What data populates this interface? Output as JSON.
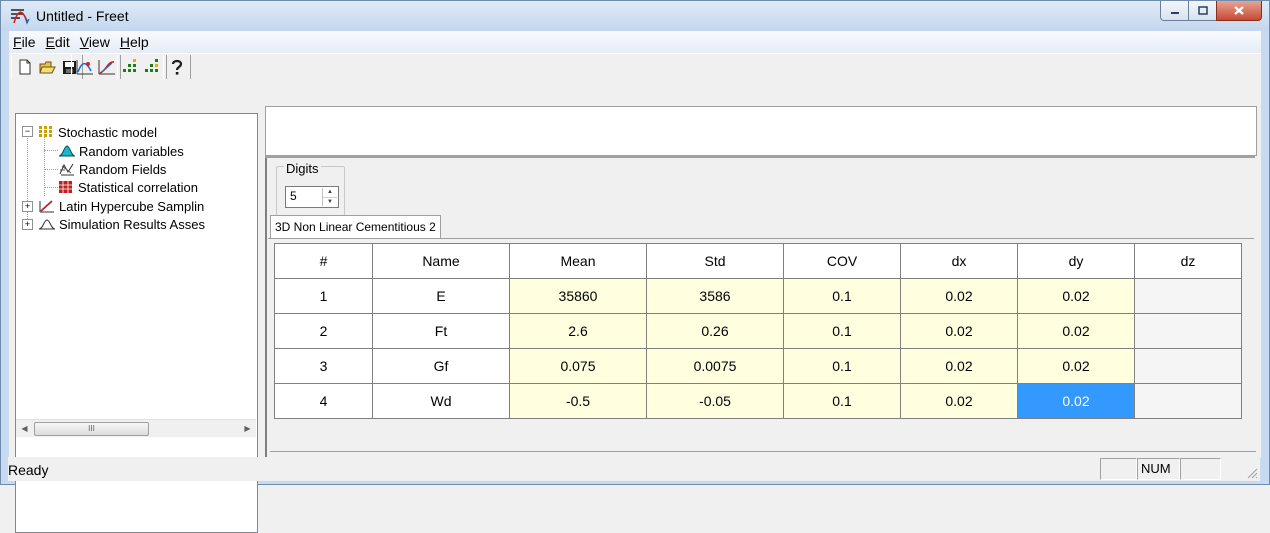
{
  "window": {
    "title": "Untitled - Freet"
  },
  "menu": [
    {
      "mnemonic": "F",
      "rest": "ile"
    },
    {
      "mnemonic": "E",
      "rest": "dit"
    },
    {
      "mnemonic": "V",
      "rest": "iew"
    },
    {
      "mnemonic": "H",
      "rest": "elp"
    }
  ],
  "toolbar": {
    "icons": [
      "new-icon",
      "open-icon",
      "save-icon",
      "curve-a-icon",
      "curve-b-icon",
      "table-a-icon",
      "table-b-icon",
      "help-icon"
    ]
  },
  "tree": {
    "items": [
      {
        "label": "Stochastic model",
        "icon": "matrix-icon"
      },
      {
        "label": "Random variables",
        "icon": "distribution-icon"
      },
      {
        "label": "Random Fields",
        "icon": "field-icon"
      },
      {
        "label": "Statistical correlation",
        "icon": "correlation-icon"
      },
      {
        "label": "Latin Hypercube Samplin",
        "icon": "lhs-icon"
      },
      {
        "label": "Simulation Results Asses",
        "icon": "results-icon"
      }
    ],
    "scroll_grip": "III"
  },
  "digits": {
    "label": "Digits",
    "value": "5"
  },
  "tab": {
    "label": "3D Non Linear Cementitious 2"
  },
  "grid": {
    "columns": [
      "#",
      "Name",
      "Mean",
      "Std",
      "COV",
      "dx",
      "dy",
      "dz"
    ],
    "rows": [
      [
        "1",
        "E",
        "35860",
        "3586",
        "0.1",
        "0.02",
        "0.02",
        ""
      ],
      [
        "2",
        "Ft",
        "2.6",
        "0.26",
        "0.1",
        "0.02",
        "0.02",
        ""
      ],
      [
        "3",
        "Gf",
        "0.075",
        "0.0075",
        "0.1",
        "0.02",
        "0.02",
        ""
      ],
      [
        "4",
        "Wd",
        "-0.5",
        "-0.05",
        "0.1",
        "0.02",
        "0.02",
        ""
      ]
    ],
    "selected_cell": {
      "row": 4,
      "column": "dy"
    }
  },
  "status": {
    "text": "Ready",
    "num": "NUM"
  },
  "colors": {
    "selection": "#3399ff",
    "editable_cell": "#ffffe0",
    "close_button": "#c74a33"
  }
}
